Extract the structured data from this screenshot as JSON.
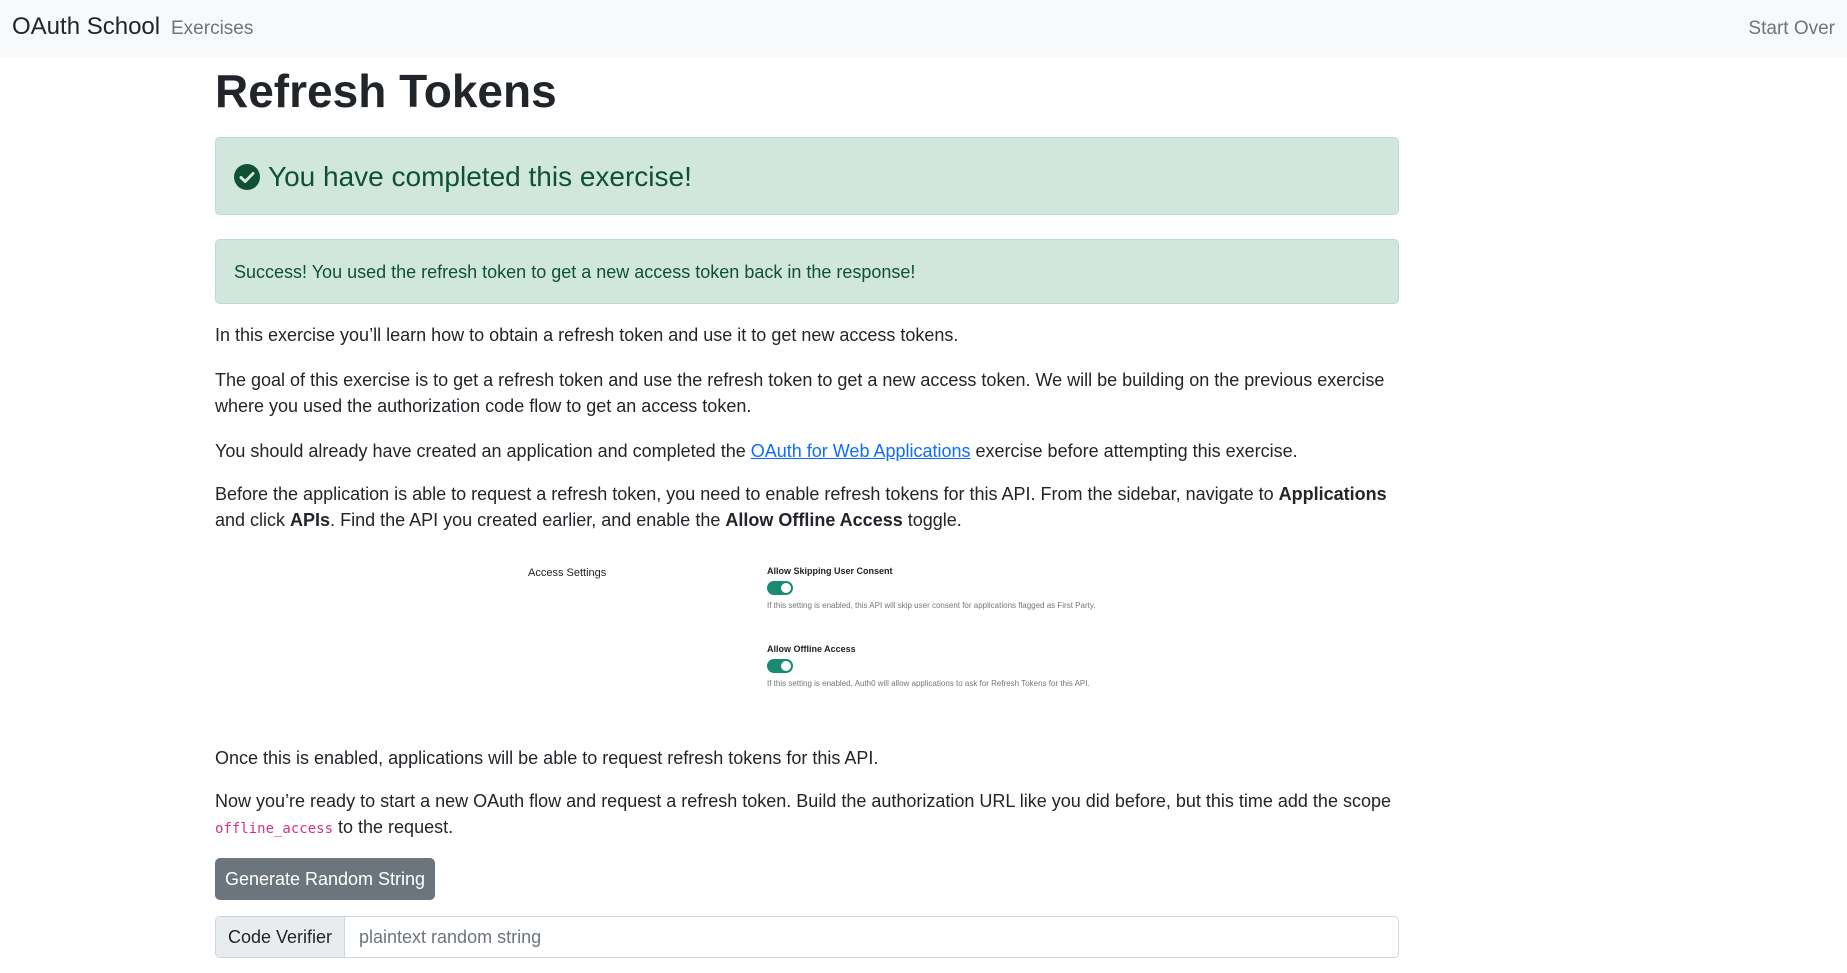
{
  "nav": {
    "brand": "OAuth School",
    "exercises": "Exercises",
    "start_over": "Start Over"
  },
  "page": {
    "title": "Refresh Tokens",
    "completed_msg": "You have completed this exercise!",
    "success_msg": "Success! You used the refresh token to get a new access token back in the response!",
    "intro": "In this exercise you’ll learn how to obtain a refresh token and use it to get new access tokens.",
    "goal": "The goal of this exercise is to get a refresh token and use the refresh token to get a new access token. We will be building on the previous exercise where you used the authorization code flow to get an access token.",
    "prereq_before": "You should already have created an application and completed the ",
    "prereq_link": "OAuth for Web Applications",
    "prereq_after": " exercise before attempting this exercise.",
    "enable_1": "Before the application is able to request a refresh token, you need to enable refresh tokens for this API. From the sidebar, navigate to ",
    "enable_applications": "Applications",
    "enable_2": " and click ",
    "enable_apis": "APIs",
    "enable_3": ". Find the API you created earlier, and enable the ",
    "enable_toggle": "Allow Offline Access",
    "enable_4": " toggle.",
    "once_enabled": "Once this is enabled, applications will be able to request refresh tokens for this API.",
    "ready_1": "Now you’re ready to start a new OAuth flow and request a refresh token. Build the authorization URL like you did before, but this time add the scope ",
    "ready_scope": "offline_access",
    "ready_2": " to the request."
  },
  "settings_image": {
    "title": "Access Settings",
    "option1_label": "Allow Skipping User Consent",
    "option1_desc": "If this setting is enabled, this API will skip user consent for applications flagged as First Party.",
    "option1_on": true,
    "option2_label": "Allow Offline Access",
    "option2_desc": "If this setting is enabled, Auth0 will allow applications to ask for Refresh Tokens for this API.",
    "option2_on": true,
    "toggle_color": "#1a8a74"
  },
  "form": {
    "generate_button": "Generate Random String",
    "code_verifier_label": "Code Verifier",
    "code_verifier_placeholder": "plaintext random string",
    "code_verifier_value": ""
  },
  "colors": {
    "success_bg": "#d1e7dd",
    "success_text": "#0f5132",
    "link": "#0d6efd",
    "secondary_button": "#6c757d"
  },
  "icons": {
    "completed": "check-circle-icon"
  }
}
